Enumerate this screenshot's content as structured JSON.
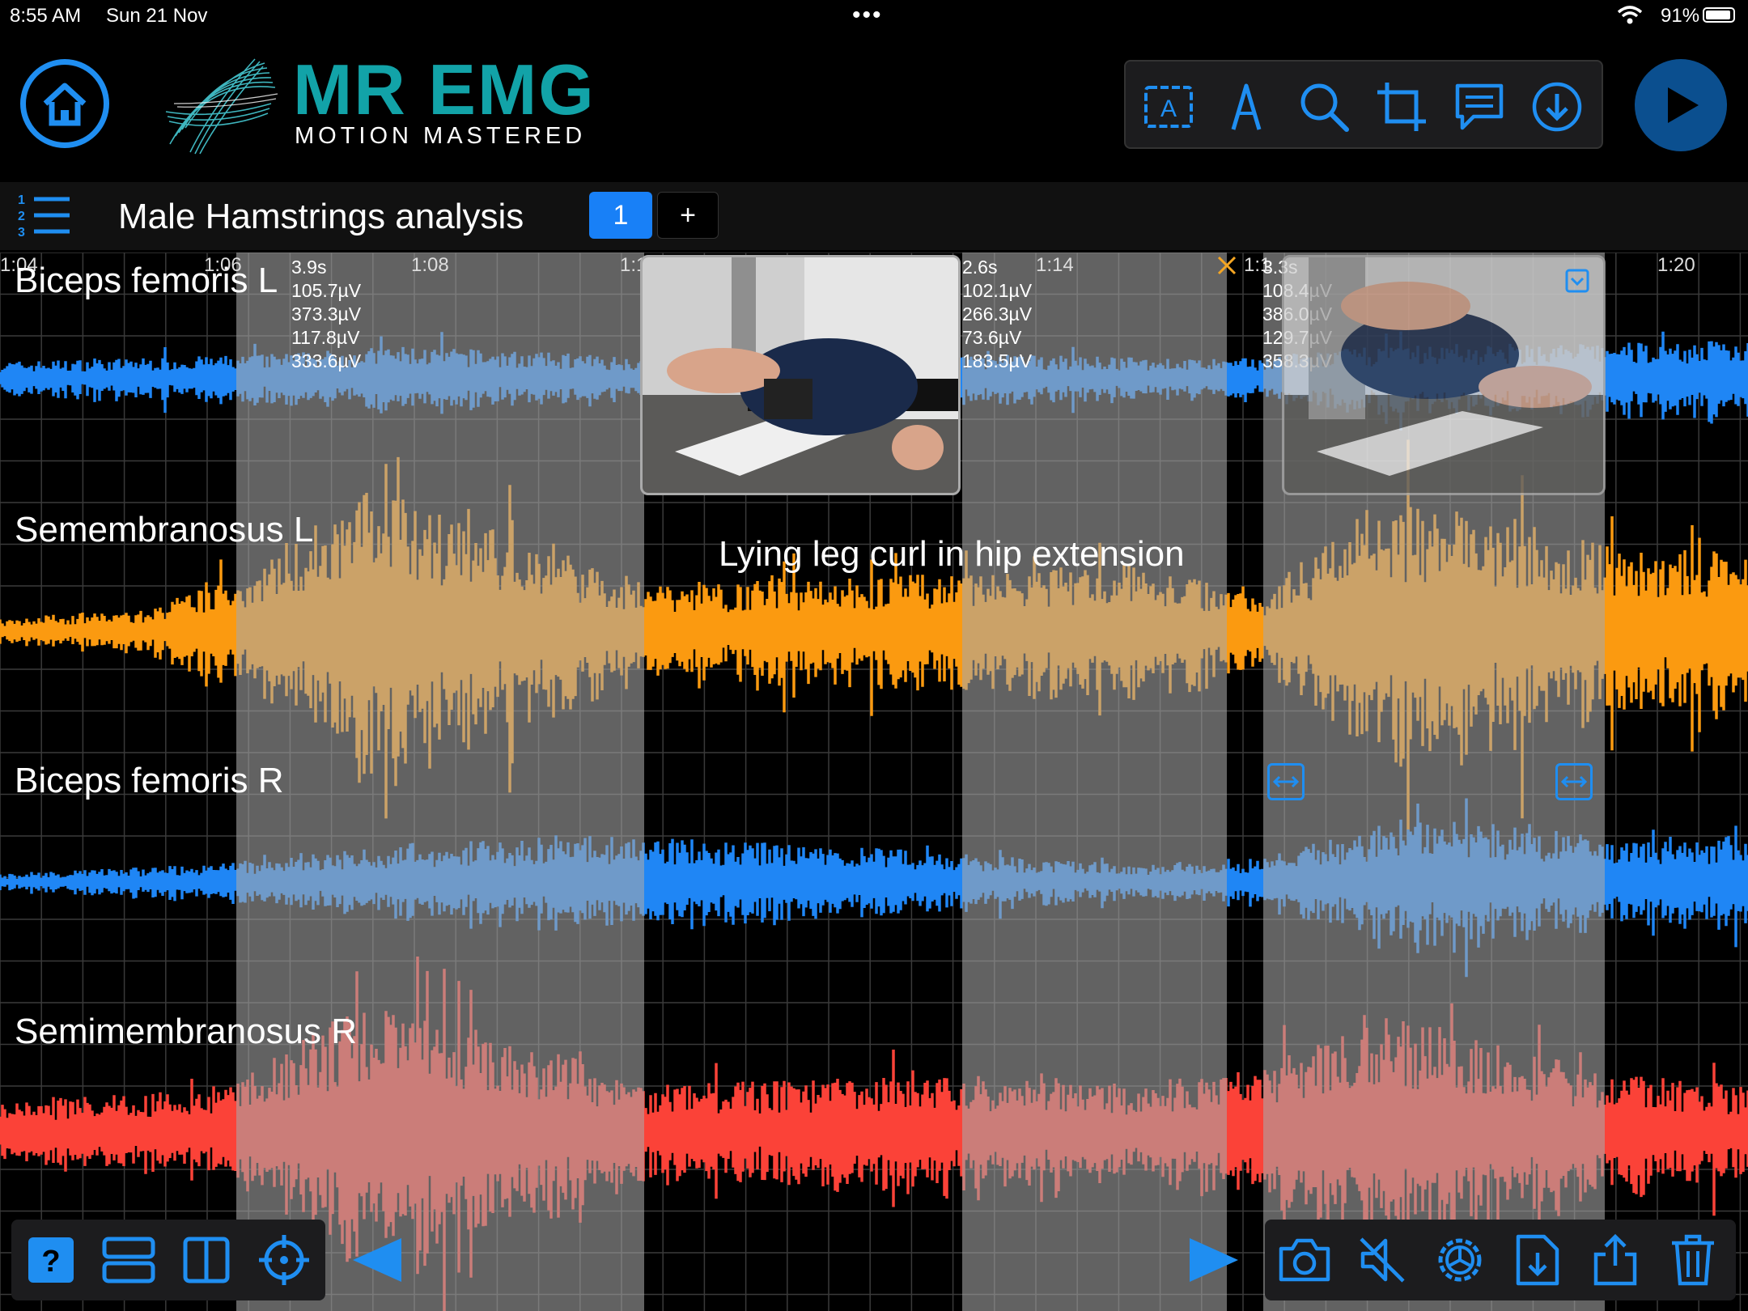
{
  "status_bar": {
    "time": "8:55 AM",
    "date": "Sun 21 Nov",
    "dots": "•••",
    "battery": "91%"
  },
  "header": {
    "logo_title": "MR EMG",
    "logo_tagline": "MOTION MASTERED",
    "toolbar_icons": [
      "text-box-icon",
      "pen-icon",
      "search-icon",
      "crop-icon",
      "comment-icon",
      "download-icon"
    ],
    "accent": "#1f8ef1"
  },
  "title_row": {
    "title": "Male Hamstrings analysis",
    "page": "1",
    "add_label": "+"
  },
  "timeline": {
    "ticks": [
      "1:04",
      "1:06",
      "1:08",
      "1:1",
      "1:14",
      "1:1",
      "1:20"
    ],
    "overlap_label": "3.3s"
  },
  "selections": [
    {
      "duration": "3.9s",
      "values": [
        "105.7µV",
        "373.3µV",
        "117.8µV",
        "333.6µV"
      ]
    },
    {
      "duration": "2.6s",
      "values": [
        "102.1µV",
        "266.3µV",
        "73.6µV",
        "183.5µV"
      ]
    },
    {
      "duration": "3.3s",
      "values": [
        "108.4µV",
        "386.0µV",
        "129.7µV",
        "358.3µV"
      ]
    }
  ],
  "channels": [
    {
      "name": "Biceps femoris L",
      "color": "#1f86f5",
      "light": "#6aa8e8"
    },
    {
      "name": "Semembranosus L",
      "color": "#fb9a10",
      "light": "#d9a866"
    },
    {
      "name": "Biceps femoris R",
      "color": "#1f86f5",
      "light": "#6aa8e8"
    },
    {
      "name": "Semimembranosus R",
      "color": "#fb4238",
      "light": "#e08884"
    }
  ],
  "caption": "Lying leg curl in hip extension",
  "bottom_left_icons": [
    "help-icon",
    "rows-layout-icon",
    "columns-layout-icon",
    "target-icon"
  ],
  "bottom_right_icons": [
    "camera-icon",
    "mute-icon",
    "settings-icon",
    "import-file-icon",
    "share-icon",
    "trash-icon"
  ]
}
